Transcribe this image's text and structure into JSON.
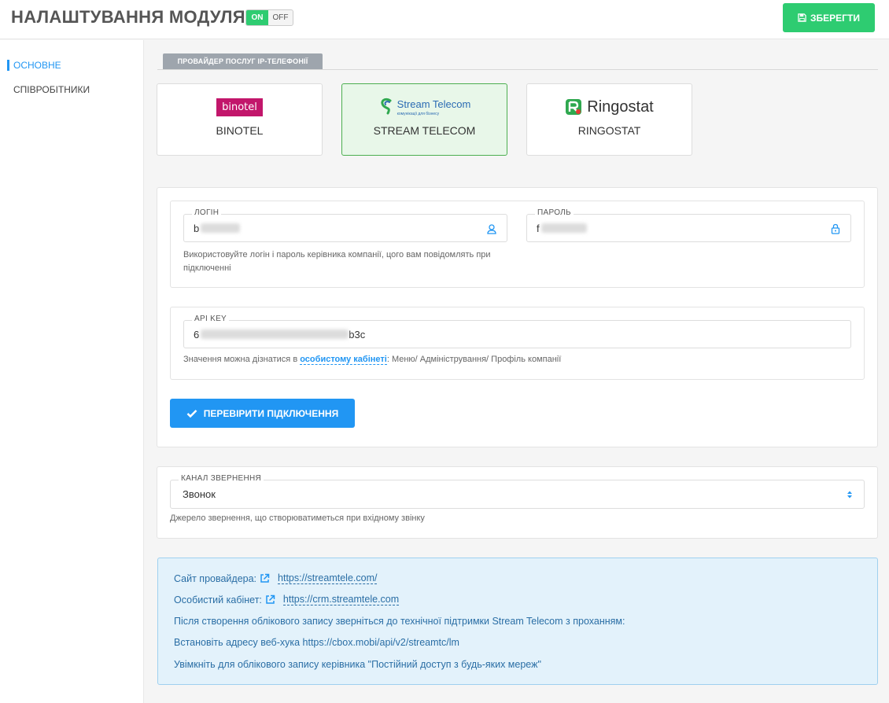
{
  "header": {
    "title": "НАЛАШТУВАННЯ МОДУЛЯ",
    "toggle_on": "ON",
    "toggle_off": "OFF",
    "save_label": "ЗБЕРЕГТИ"
  },
  "sidebar": {
    "items": [
      {
        "label": "ОСНОВНЕ",
        "active": true
      },
      {
        "label": "СПІВРОБІТНИКИ",
        "active": false
      }
    ]
  },
  "providers": {
    "tab_label": "ПРОВАЙДЕР ПОСЛУГ IP-ТЕЛЕФОНІЇ",
    "cards": [
      {
        "name": "BINOTEL",
        "logo_text": "binotel",
        "selected": false
      },
      {
        "name": "STREAM TELECOM",
        "logo_text": "Stream Telecom",
        "logo_sub": "комунікації для бізнесу",
        "selected": true
      },
      {
        "name": "RINGOSTAT",
        "logo_text": "Ringostat",
        "selected": false
      }
    ]
  },
  "credentials": {
    "login_label": "ЛОГІН",
    "login_value": "b",
    "password_label": "ПАРОЛЬ",
    "password_value": "f",
    "login_help": "Використовуйте логін і пароль керівника компанії, цого вам повідомлять при підключенні"
  },
  "api": {
    "label": "API KEY",
    "value_prefix": "6",
    "value_suffix": "b3c",
    "help_before": "Значення можна дізнатися в ",
    "help_link": "особистому кабінеті",
    "help_after": ": Меню/ Адміністрування/ Профіль компанії"
  },
  "check_button_label": "ПЕРЕВІРИТИ ПІДКЛЮЧЕННЯ",
  "channel": {
    "label": "КАНАЛ ЗВЕРНЕННЯ",
    "selected": "Звонок",
    "help": "Джерело звернення, що створюватиметься при вхідному звінку"
  },
  "info": {
    "site_label": "Сайт провайдера:",
    "site_url": "https://streamtele.com/",
    "cabinet_label": "Особистий кабінет:",
    "cabinet_url": "https://crm.streamtele.com",
    "line3": "Після створення облікового запису зверніться до технічної підтримки Stream Telecom з проханням:",
    "line4": "Встановіть адресу веб-хука https://cbox.mobi/api/v2/streamtc/lm",
    "line5": "Увімкніть для облікового запису керівника \"Постійний доступ з будь-яких мереж\""
  },
  "colors": {
    "accent": "#2196f3",
    "success": "#2ecc71",
    "binotel": "#c2166b"
  }
}
